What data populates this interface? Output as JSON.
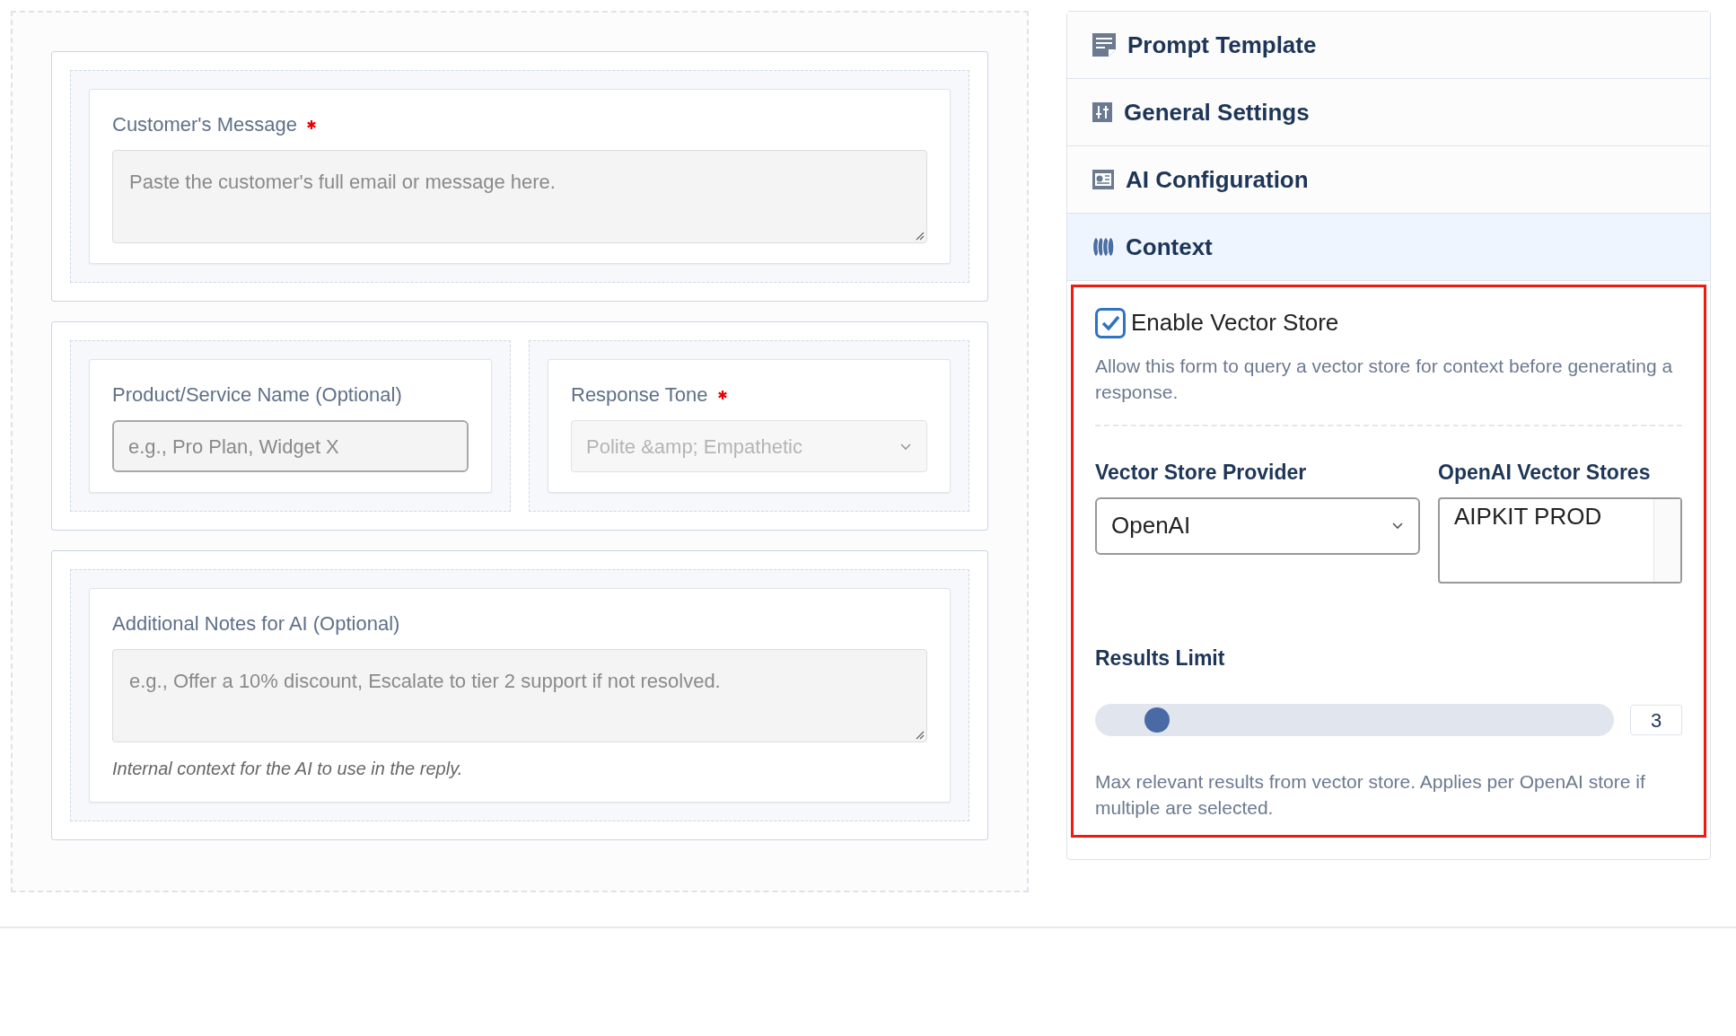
{
  "form_sections": [
    {
      "fields": [
        {
          "kind": "textarea",
          "label": "Customer's Message",
          "required": true,
          "placeholder": "Paste the customer's full email or message here."
        }
      ]
    },
    {
      "fields": [
        {
          "kind": "input",
          "label": "Product/Service Name (Optional)",
          "required": false,
          "placeholder": "e.g., Pro Plan, Widget X"
        },
        {
          "kind": "select",
          "label": "Response Tone",
          "required": true,
          "value": "Polite &amp; Empathetic",
          "disabled": true
        }
      ]
    },
    {
      "fields": [
        {
          "kind": "textarea",
          "label": "Additional Notes for AI (Optional)",
          "required": false,
          "placeholder": "e.g., Offer a 10% discount, Escalate to tier 2 support if not resolved.",
          "help": "Internal context for the AI to use in the reply."
        }
      ]
    }
  ],
  "sidebar": {
    "sections": [
      {
        "title": "Prompt Template",
        "expanded": false
      },
      {
        "title": "General Settings",
        "expanded": false
      },
      {
        "title": "AI Configuration",
        "expanded": false
      },
      {
        "title": "Context",
        "expanded": true
      }
    ]
  },
  "context_panel": {
    "enable_checkbox": {
      "label": "Enable Vector Store",
      "checked": true
    },
    "description": "Allow this form to query a vector store for context before generating a response.",
    "provider": {
      "label": "Vector Store Provider",
      "value": "OpenAI"
    },
    "stores": {
      "label": "OpenAI Vector Stores",
      "options": [
        {
          "label": "AIPKIT PROD",
          "selected": false
        }
      ]
    },
    "results_limit": {
      "label": "Results Limit",
      "level": 0.1,
      "reading": "3",
      "help": "Max relevant results from vector store. Applies per OpenAI store if multiple are selected."
    }
  }
}
